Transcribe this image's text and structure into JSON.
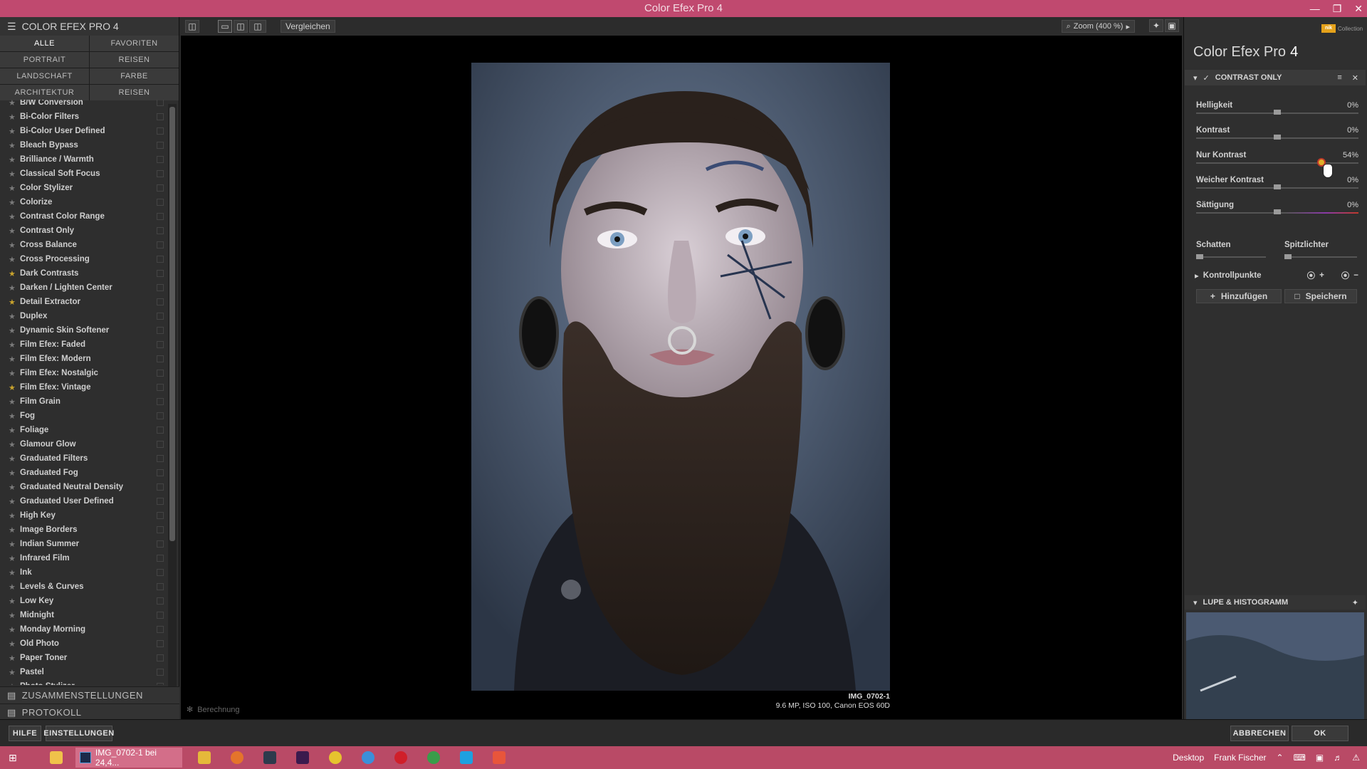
{
  "window": {
    "title": "Color Efex Pro 4"
  },
  "left_panel": {
    "header": "COLOR EFEX PRO 4",
    "categories": [
      "ALLE",
      "FAVORITEN",
      "PORTRAIT",
      "REISEN",
      "LANDSCHAFT",
      "FARBE",
      "ARCHITEKTUR",
      "REISEN"
    ],
    "filters": [
      {
        "name": "B/W Conversion",
        "fav": false
      },
      {
        "name": "Bi-Color Filters",
        "fav": false
      },
      {
        "name": "Bi-Color User Defined",
        "fav": false
      },
      {
        "name": "Bleach Bypass",
        "fav": false
      },
      {
        "name": "Brilliance / Warmth",
        "fav": false
      },
      {
        "name": "Classical Soft Focus",
        "fav": false
      },
      {
        "name": "Color Stylizer",
        "fav": false
      },
      {
        "name": "Colorize",
        "fav": false
      },
      {
        "name": "Contrast Color Range",
        "fav": false
      },
      {
        "name": "Contrast Only",
        "fav": false
      },
      {
        "name": "Cross Balance",
        "fav": false
      },
      {
        "name": "Cross Processing",
        "fav": false
      },
      {
        "name": "Dark Contrasts",
        "fav": true
      },
      {
        "name": "Darken / Lighten Center",
        "fav": false
      },
      {
        "name": "Detail Extractor",
        "fav": true
      },
      {
        "name": "Duplex",
        "fav": false
      },
      {
        "name": "Dynamic Skin Softener",
        "fav": false
      },
      {
        "name": "Film Efex: Faded",
        "fav": false
      },
      {
        "name": "Film Efex: Modern",
        "fav": false
      },
      {
        "name": "Film Efex: Nostalgic",
        "fav": false
      },
      {
        "name": "Film Efex: Vintage",
        "fav": true
      },
      {
        "name": "Film Grain",
        "fav": false
      },
      {
        "name": "Fog",
        "fav": false
      },
      {
        "name": "Foliage",
        "fav": false
      },
      {
        "name": "Glamour Glow",
        "fav": false
      },
      {
        "name": "Graduated Filters",
        "fav": false
      },
      {
        "name": "Graduated Fog",
        "fav": false
      },
      {
        "name": "Graduated Neutral Density",
        "fav": false
      },
      {
        "name": "Graduated User Defined",
        "fav": false
      },
      {
        "name": "High Key",
        "fav": false
      },
      {
        "name": "Image Borders",
        "fav": false
      },
      {
        "name": "Indian Summer",
        "fav": false
      },
      {
        "name": "Infrared Film",
        "fav": false
      },
      {
        "name": "Ink",
        "fav": false
      },
      {
        "name": "Levels & Curves",
        "fav": false
      },
      {
        "name": "Low Key",
        "fav": false
      },
      {
        "name": "Midnight",
        "fav": false
      },
      {
        "name": "Monday Morning",
        "fav": false
      },
      {
        "name": "Old Photo",
        "fav": false
      },
      {
        "name": "Paper Toner",
        "fav": false
      },
      {
        "name": "Pastel",
        "fav": false
      },
      {
        "name": "Photo Stylizer",
        "fav": false
      }
    ],
    "footer_presets": "ZUSAMMENSTELLUNGEN",
    "footer_history": "PROTOKOLL"
  },
  "toolbar": {
    "compare": "Vergleichen",
    "zoom": "Zoom (400 %)"
  },
  "canvas": {
    "calculating": "Berechnung",
    "image_name": "IMG_0702-1",
    "image_meta": "9.6 MP, ISO 100, Canon EOS 60D"
  },
  "right_panel": {
    "brand": "Collection",
    "brand_logo": "nik",
    "app_name": "Color Efex Pro",
    "app_version": "4",
    "filter_title": "CONTRAST ONLY",
    "sliders": [
      {
        "label": "Helligkeit",
        "value": "0%",
        "level": 0.5
      },
      {
        "label": "Kontrast",
        "value": "0%",
        "level": 0.5
      },
      {
        "label": "Nur Kontrast",
        "value": "54%",
        "level": 0.77
      },
      {
        "label": "Weicher Kontrast",
        "value": "0%",
        "level": 0.5
      },
      {
        "label": "Sättigung",
        "value": "0%",
        "level": 0.5
      }
    ],
    "shadows": "Schatten",
    "highlights": "Spitzlichter",
    "control_points": "Kontrollpunkte",
    "add": "Hinzufügen",
    "save": "Speichern",
    "loupe": "LUPE & HISTOGRAMM"
  },
  "bottom": {
    "help": "HILFE",
    "settings": "EINSTELLUNGEN",
    "cancel": "ABBRECHEN",
    "ok": "OK"
  },
  "taskbar": {
    "active_task": "IMG_0702-1 bei 24,4...",
    "desktop": "Desktop",
    "user": "Frank Fischer"
  }
}
